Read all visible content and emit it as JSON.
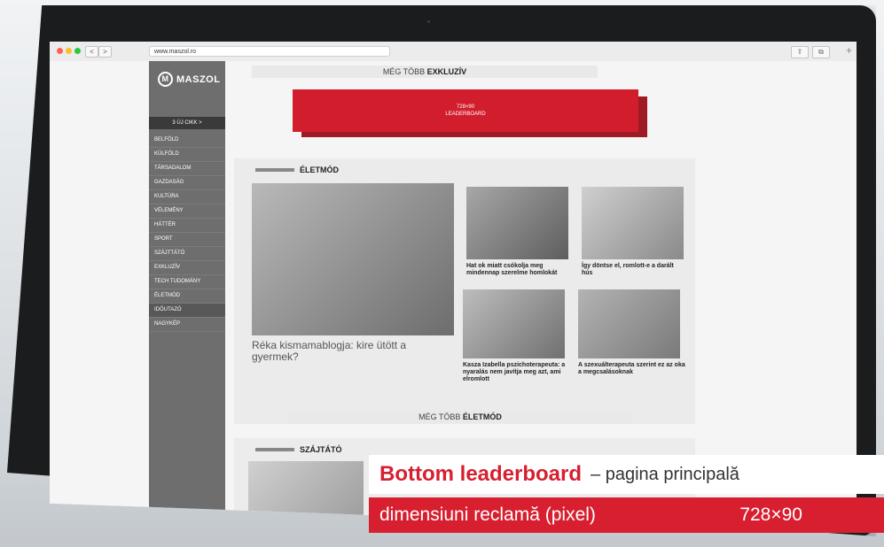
{
  "browser": {
    "url": "www.maszol.ro",
    "back": "<",
    "forward": ">",
    "share_icon": "share-icon",
    "tabs_icon": "tabs-icon",
    "new_tab": "+"
  },
  "site": {
    "logo": "MASZOL",
    "logo_mark": "M",
    "new_articles": "3 ÚJ CIKK >",
    "menu": [
      "BELFÖLD",
      "KÜLFÖLD",
      "TÁRSADALOM",
      "GAZDASÁG",
      "KULTÚRA",
      "VÉLEMÉNY",
      "HÁTTÉR",
      "SPORT",
      "SZÁJTTÁTÓ",
      "EXKLUZÍV",
      "TECH TUDOMÁNY",
      "ÉLETMÓD",
      "IDŐUTAZÓ",
      "NAGYKÉP"
    ],
    "more_exklusiv": {
      "prefix": "MÉG TÖBB",
      "bold": "EXKLUZÍV"
    },
    "ad": {
      "size": "728×90",
      "label": "LEADERBOARD"
    },
    "section_title": "ÉLETMÓD",
    "main_article": "Réka kismamablogja: kire ütött a gyermek?",
    "articles": [
      "Hat ok miatt csókolja meg mindennap szerelme homlokát",
      "Így döntse el, romlott-e a darált hús",
      "Kasza Izabella pszichoterapeuta: a nyaralás nem javítja meg azt, ami elromlott",
      "A szexuálterapeuta szerint ez az oka a megcsalásoknak"
    ],
    "more_eletmod": {
      "prefix": "MÉG TÖBB",
      "bold": "ÉLETMÓD"
    },
    "section2_title": "SZÁJTÁTÓ"
  },
  "overlay": {
    "title_strong": "Bottom leaderboard",
    "title_rest": "– pagina principală",
    "dims_label": "dimensiuni reclamă (pixel)",
    "dims_value": "728×90"
  },
  "colors": {
    "accent": "#d71f30",
    "sidebar": "#6e6e6e"
  }
}
